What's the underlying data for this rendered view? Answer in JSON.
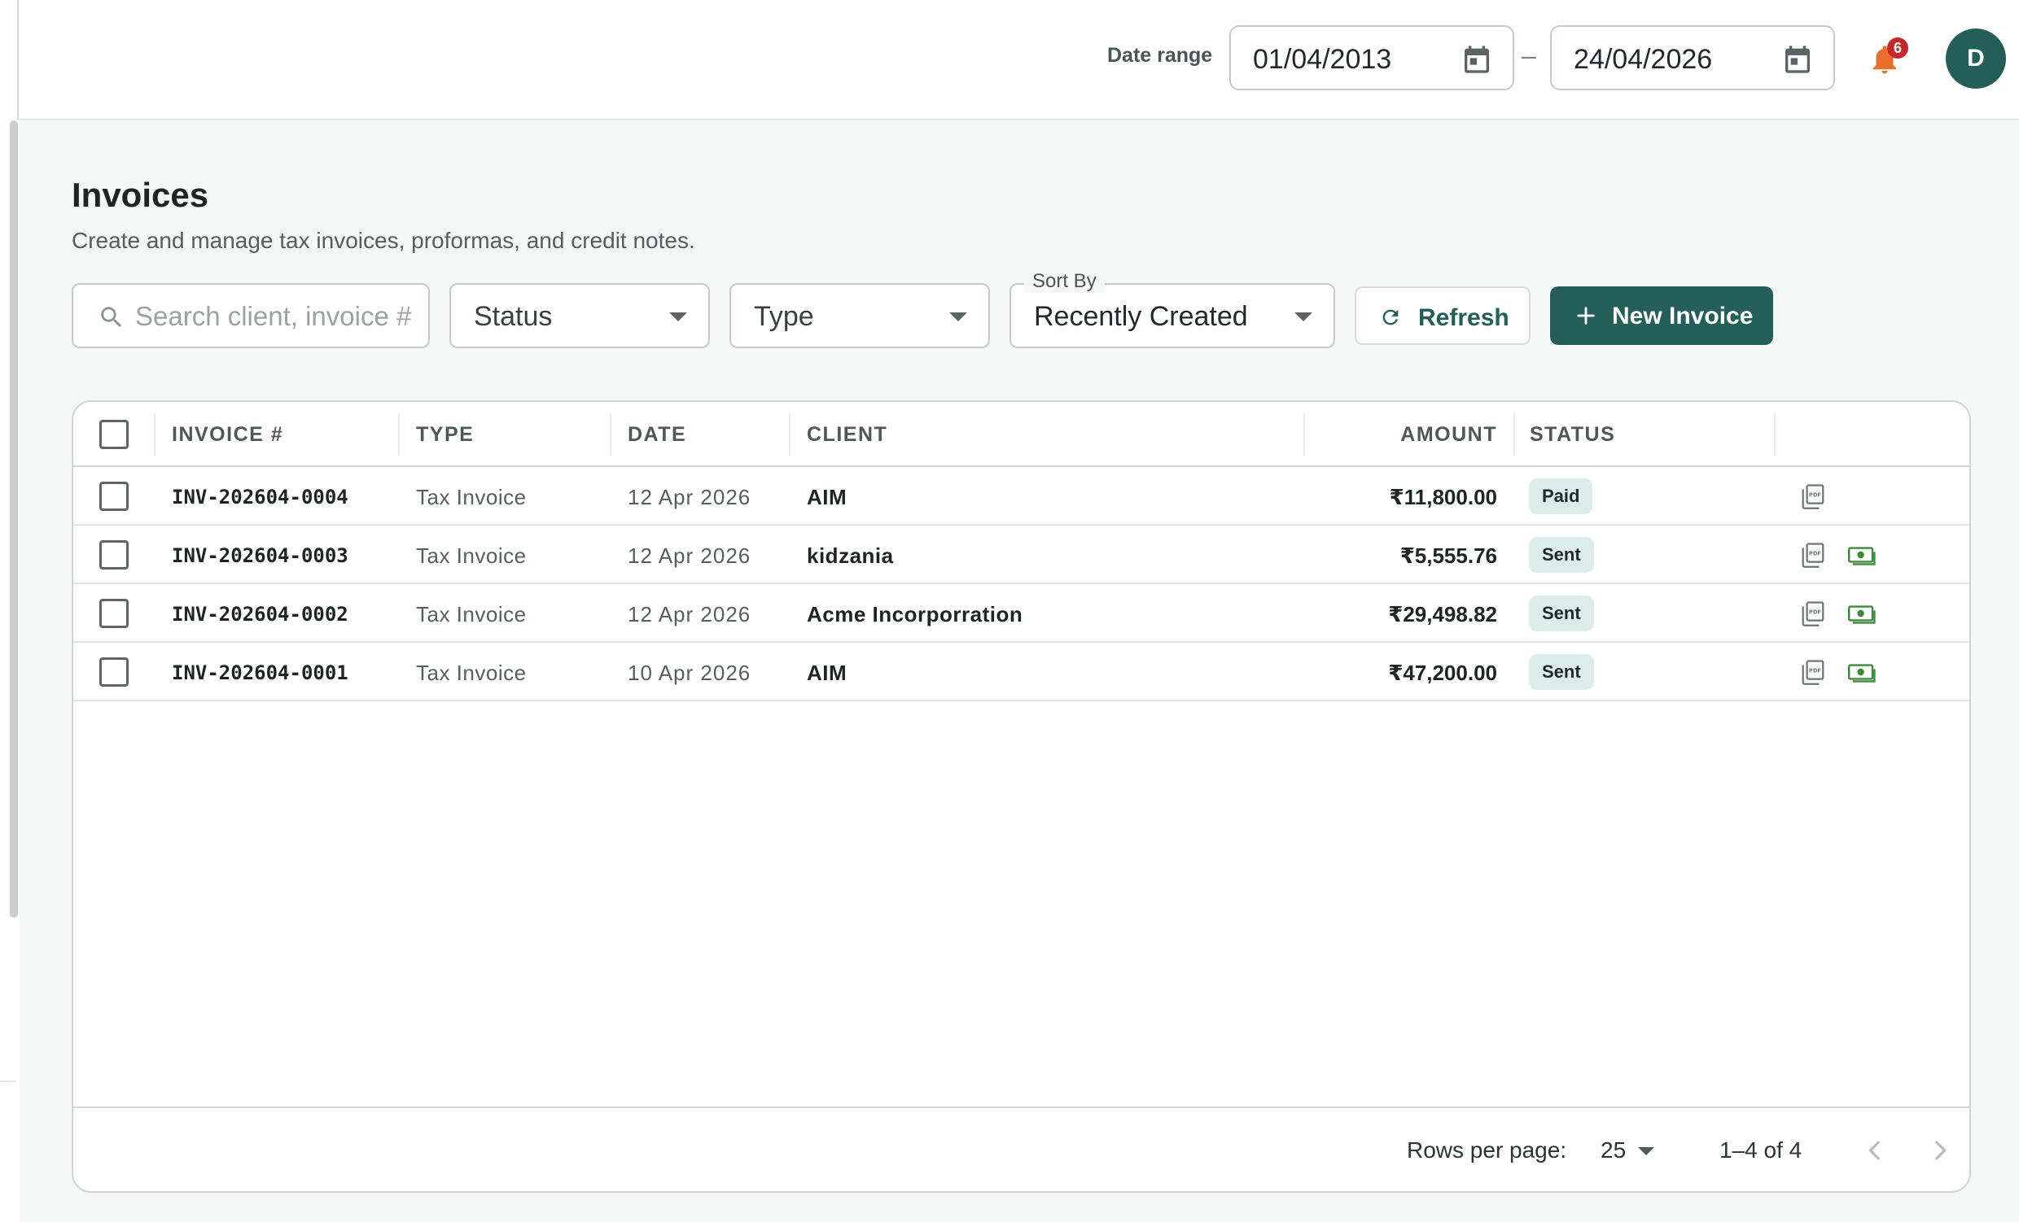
{
  "header": {
    "date_range_label": "Date range",
    "start_date": "01/04/2013",
    "date_separator": "–",
    "end_date": "24/04/2026",
    "notification_count": "6",
    "avatar_initial": "D"
  },
  "page": {
    "title": "Invoices",
    "subtitle": "Create and manage tax invoices, proformas, and credit notes."
  },
  "toolbar": {
    "search_placeholder": "Search client, invoice #",
    "status_filter": "Status",
    "type_filter": "Type",
    "sort_label": "Sort By",
    "sort_value": "Recently Created",
    "refresh_label": "Refresh",
    "new_invoice_label": "New Invoice"
  },
  "table": {
    "columns": {
      "invoice": "INVOICE #",
      "type": "TYPE",
      "date": "DATE",
      "client": "CLIENT",
      "amount": "AMOUNT",
      "status": "STATUS"
    },
    "rows": [
      {
        "invoice": "INV-202604-0004",
        "type": "Tax Invoice",
        "date": "12 Apr 2026",
        "client": "AIM",
        "amount": "₹11,800.00",
        "status": "Paid"
      },
      {
        "invoice": "INV-202604-0003",
        "type": "Tax Invoice",
        "date": "12 Apr 2026",
        "client": "kidzania",
        "amount": "₹5,555.76",
        "status": "Sent"
      },
      {
        "invoice": "INV-202604-0002",
        "type": "Tax Invoice",
        "date": "12 Apr 2026",
        "client": "Acme Incorporration",
        "amount": "₹29,498.82",
        "status": "Sent"
      },
      {
        "invoice": "INV-202604-0001",
        "type": "Tax Invoice",
        "date": "10 Apr 2026",
        "client": "AIM",
        "amount": "₹47,200.00",
        "status": "Sent"
      }
    ]
  },
  "pagination": {
    "rows_per_page_label": "Rows per page:",
    "rows_per_page": "25",
    "range": "1–4 of 4"
  },
  "colors": {
    "primary": "#255f59",
    "background": "#f4f8f7",
    "status_badge_bg": "#dcecea",
    "notification_bell": "#e8702a",
    "notification_badge": "#c62828",
    "payment_icon": "#3a8a3a"
  },
  "icons": {
    "calendar": "calendar-icon",
    "bell": "bell-icon",
    "search": "search-icon",
    "refresh": "refresh-icon",
    "add": "plus-icon",
    "pdf": "pdf-icon",
    "payment": "cash-icon",
    "prev": "chevron-left-icon",
    "next": "chevron-right-icon"
  }
}
